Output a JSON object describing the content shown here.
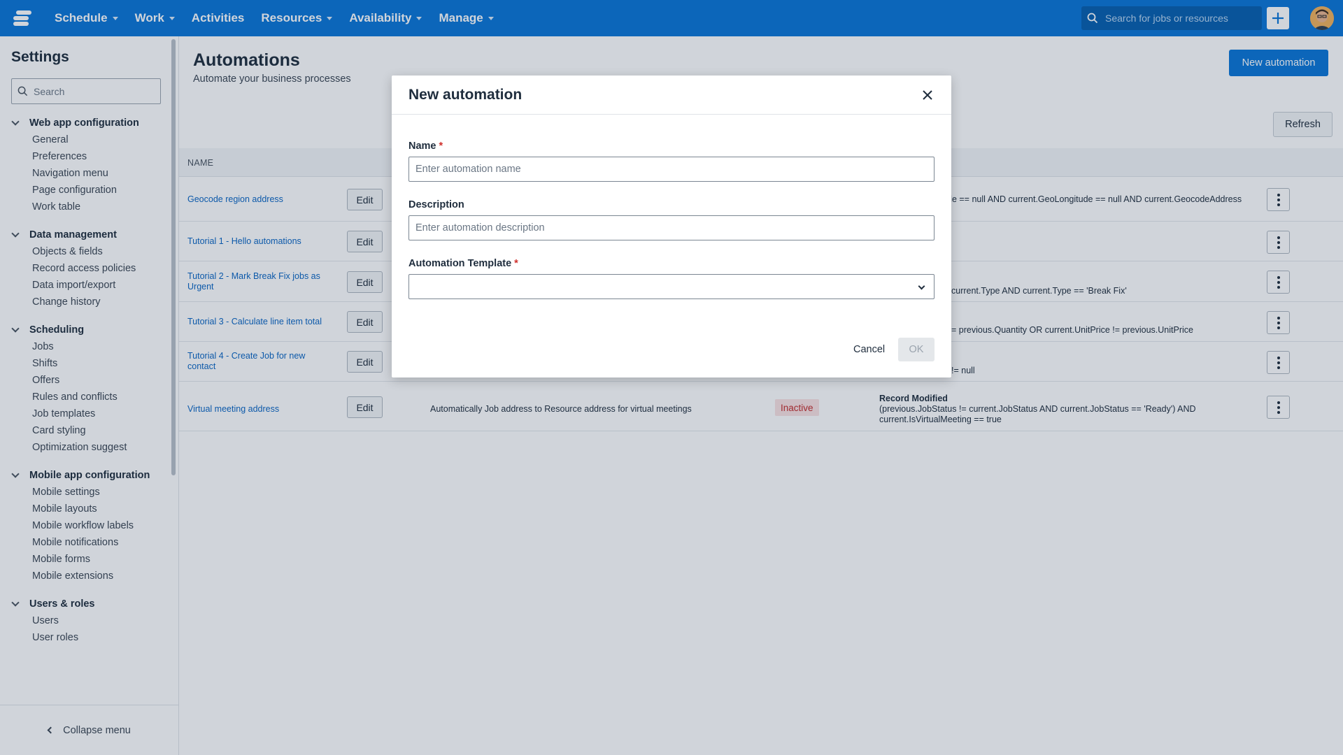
{
  "topbar": {
    "nav": [
      {
        "label": "Schedule",
        "has_caret": true
      },
      {
        "label": "Work",
        "has_caret": true
      },
      {
        "label": "Activities",
        "has_caret": false
      },
      {
        "label": "Resources",
        "has_caret": true
      },
      {
        "label": "Availability",
        "has_caret": true
      },
      {
        "label": "Manage",
        "has_caret": true
      }
    ],
    "search_placeholder": "Search for jobs or resources",
    "icons": {
      "logo": "app-logo-icon",
      "search": "search-icon",
      "plus": "plus-icon",
      "avatar": "user-avatar"
    }
  },
  "sidebar": {
    "title": "Settings",
    "search_placeholder": "Search",
    "groups": [
      {
        "label": "Web app configuration",
        "items": [
          "General",
          "Preferences",
          "Navigation menu",
          "Page configuration",
          "Work table"
        ]
      },
      {
        "label": "Data management",
        "items": [
          "Objects & fields",
          "Record access policies",
          "Data import/export",
          "Change history"
        ]
      },
      {
        "label": "Scheduling",
        "items": [
          "Jobs",
          "Shifts",
          "Offers",
          "Rules and conflicts",
          "Job templates",
          "Card styling",
          "Optimization suggest"
        ]
      },
      {
        "label": "Mobile app configuration",
        "items": [
          "Mobile settings",
          "Mobile layouts",
          "Mobile workflow labels",
          "Mobile notifications",
          "Mobile forms",
          "Mobile extensions"
        ]
      },
      {
        "label": "Users & roles",
        "items": [
          "Users",
          "User roles"
        ]
      }
    ],
    "collapse_label": "Collapse menu"
  },
  "main": {
    "title": "Automations",
    "subtitle": "Automate your business processes",
    "new_button": "New automation",
    "refresh_button": "Refresh",
    "table": {
      "name_header": "NAME",
      "edit_label": "Edit",
      "rows": [
        {
          "name": "Geocode region address",
          "description": "",
          "status": "",
          "trigger_title": "",
          "trigger": "de == null AND current.GeoLongitude == null AND current.GeocodeAddress"
        },
        {
          "name": "Tutorial 1 - Hello automations",
          "description": "",
          "status": "",
          "trigger_title": "",
          "trigger": ""
        },
        {
          "name": "Tutorial 2 - Mark Break Fix jobs as Urgent",
          "description": "",
          "status": "",
          "trigger_title": "",
          "trigger": "current.Type AND current.Type == 'Break Fix'"
        },
        {
          "name": "Tutorial 3 - Calculate line item total",
          "description": "",
          "status": "",
          "trigger_title": "",
          "trigger": "= previous.Quantity OR current.UnitPrice != previous.UnitPrice"
        },
        {
          "name": "Tutorial 4 - Create Job for new contact",
          "description": "",
          "status": "",
          "trigger_title": "",
          "trigger": "!= null"
        },
        {
          "name": "Virtual meeting address",
          "description": "Automatically Job address to Resource address for virtual meetings",
          "status": "Inactive",
          "trigger_title": "Record Modified",
          "trigger": "(previous.JobStatus != current.JobStatus AND current.JobStatus == 'Ready') AND current.IsVirtualMeeting == true"
        }
      ]
    }
  },
  "modal": {
    "title": "New automation",
    "name_label": "Name",
    "name_placeholder": "Enter automation name",
    "name_value": "",
    "description_label": "Description",
    "description_placeholder": "Enter automation description",
    "description_value": "",
    "template_label": "Automation Template",
    "template_value": "",
    "required_marker": "*",
    "cancel_label": "Cancel",
    "ok_label": "OK",
    "ok_disabled": true
  },
  "colors": {
    "brand": "#0b76d8",
    "link": "#0b66c3",
    "danger_text": "#c42b2b",
    "danger_bg": "#fbe3e3"
  }
}
